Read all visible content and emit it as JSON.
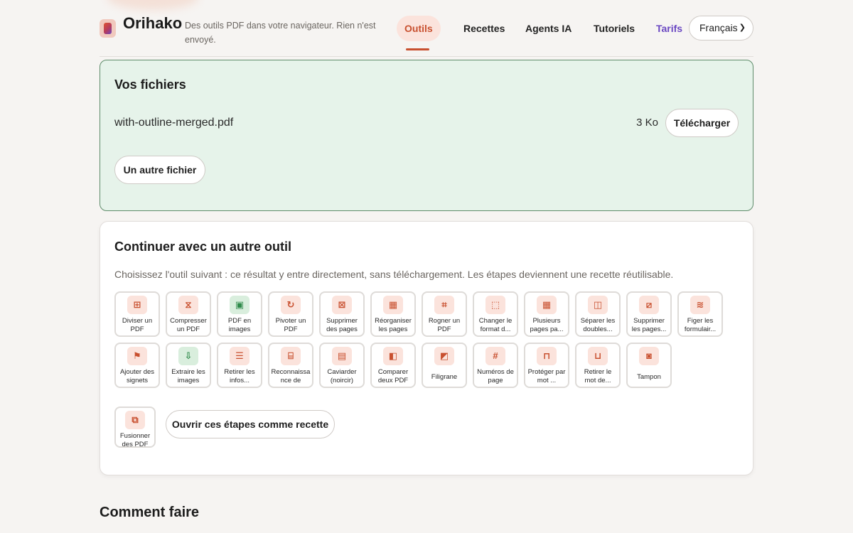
{
  "header": {
    "brand": "Orihako",
    "tagline": "Des outils PDF dans votre navigateur. Rien n'est envoyé.",
    "nav": [
      "Outils",
      "Recettes",
      "Agents IA",
      "Tutoriels",
      "Tarifs"
    ],
    "language": "Français",
    "accent_color": "#c8502f",
    "pricing_color": "#6a47c2"
  },
  "files": {
    "title": "Vos fichiers",
    "file_name": "with-outline-merged.pdf",
    "file_size": "3 Ko",
    "download_label": "Télécharger",
    "other_file_label": "Un autre fichier"
  },
  "tools": {
    "title": "Continuer avec un autre outil",
    "description": "Choisissez l'outil suivant : ce résultat y entre directement, sans téléchargement. Les étapes deviennent une recette réutilisable.",
    "items": [
      {
        "label": "Diviser un PDF",
        "icon": "split-icon"
      },
      {
        "label": "Compresser un PDF",
        "icon": "compress-icon"
      },
      {
        "label": "PDF en images",
        "icon": "pdf-to-images-icon"
      },
      {
        "label": "Pivoter un PDF",
        "icon": "rotate-icon"
      },
      {
        "label": "Supprimer des pages",
        "icon": "delete-pages-icon"
      },
      {
        "label": "Réorganiser les pages",
        "icon": "reorder-icon"
      },
      {
        "label": "Rogner un PDF",
        "icon": "crop-icon"
      },
      {
        "label": "Changer le format d...",
        "icon": "resize-icon"
      },
      {
        "label": "Plusieurs pages pa...",
        "icon": "n-up-icon"
      },
      {
        "label": "Séparer les doubles...",
        "icon": "split-spreads-icon"
      },
      {
        "label": "Supprimer les pages...",
        "icon": "remove-blank-icon"
      },
      {
        "label": "Figer les formulair...",
        "icon": "flatten-icon"
      },
      {
        "label": "Ajouter des signets",
        "icon": "bookmark-icon"
      },
      {
        "label": "Extraire les images",
        "icon": "extract-images-icon"
      },
      {
        "label": "Retirer les infos...",
        "icon": "metadata-icon"
      },
      {
        "label": "Reconnaissance de texte...",
        "icon": "ocr-icon"
      },
      {
        "label": "Caviarder (noircir)",
        "icon": "redact-icon"
      },
      {
        "label": "Comparer deux PDF",
        "icon": "compare-icon"
      },
      {
        "label": "Filigrane",
        "icon": "watermark-icon"
      },
      {
        "label": "Numéros de page",
        "icon": "page-numbers-icon"
      },
      {
        "label": "Protéger par mot ...",
        "icon": "lock-icon"
      },
      {
        "label": "Retirer le mot de...",
        "icon": "unlock-icon"
      },
      {
        "label": "Tampon",
        "icon": "stamp-icon"
      },
      {
        "label": "Fusionner des PDF",
        "icon": "merge-icon"
      }
    ],
    "recipe_label": "Ouvrir ces étapes comme recette"
  },
  "howto": {
    "title": "Comment faire"
  }
}
